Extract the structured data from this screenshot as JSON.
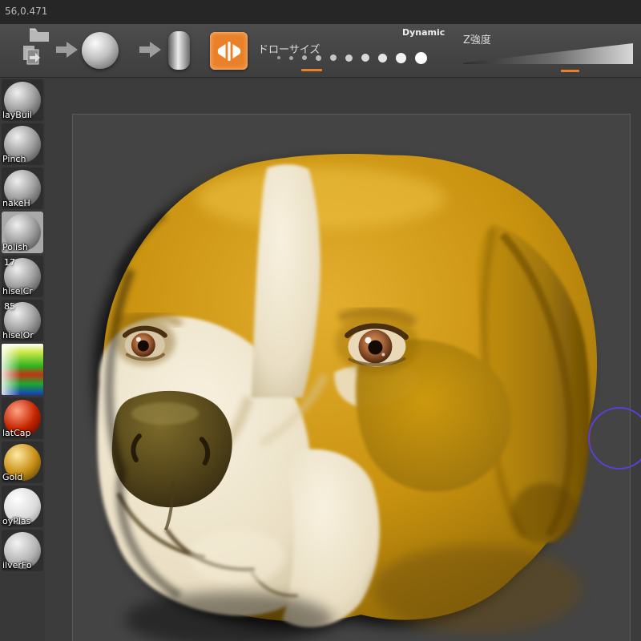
{
  "titlebar": {
    "coords": "56,0.471"
  },
  "toolbar": {
    "draw_size_label": "ドローサイズ",
    "dynamic_label": "Dynamic",
    "z_intensity_label": "Z強度",
    "accent_color": "#e9812a"
  },
  "sidebar": {
    "items": [
      {
        "label": "layBuil"
      },
      {
        "label": "Pinch"
      },
      {
        "label": "nakeH"
      },
      {
        "label": "Polish",
        "selected": true
      },
      {
        "label": "hiselCr",
        "badge": "17"
      },
      {
        "label": "hiselOr",
        "badge": "85"
      },
      {
        "label": "",
        "type": "color-picker"
      },
      {
        "label": "latCap"
      },
      {
        "label": "Gold"
      },
      {
        "label": "oyPlas"
      },
      {
        "label": "ilverFo"
      }
    ]
  },
  "canvas": {
    "cursor_color": "#5b3fd6"
  }
}
